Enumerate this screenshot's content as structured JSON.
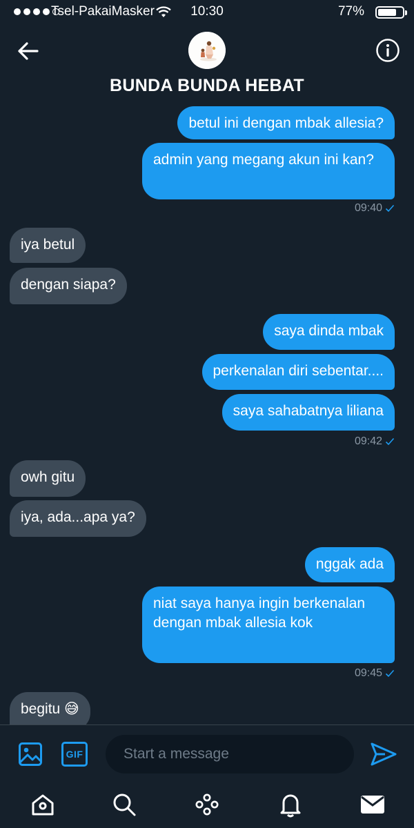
{
  "status_bar": {
    "carrier": "Tsel-PakaiMasker",
    "time": "10:30",
    "battery": "77%",
    "battery_level": 0.77
  },
  "header": {
    "title": "BUNDA BUNDA HEBAT",
    "avatar_icon": "group-avatar-icon"
  },
  "messages": [
    {
      "dir": "sent",
      "text": "betul ini dengan mbak allesia?"
    },
    {
      "dir": "sent",
      "text": "admin yang megang akun ini kan?"
    },
    {
      "time": "09:40"
    },
    {
      "dir": "recv",
      "text": "iya betul"
    },
    {
      "dir": "recv",
      "text": "dengan siapa?"
    },
    {
      "dir": "sent",
      "text": "saya dinda mbak"
    },
    {
      "dir": "sent",
      "text": "perkenalan diri sebentar...."
    },
    {
      "dir": "sent",
      "text": "saya sahabatnya liliana"
    },
    {
      "time": "09:42"
    },
    {
      "dir": "recv",
      "text": "owh gitu"
    },
    {
      "dir": "recv",
      "text": "iya, ada...apa ya?"
    },
    {
      "dir": "sent",
      "text": "nggak ada"
    },
    {
      "dir": "sent",
      "text": "niat saya hanya ingin berkenalan dengan mbak allesia kok"
    },
    {
      "time": "09:45"
    },
    {
      "dir": "recv",
      "text": "begitu 😅"
    }
  ],
  "composer": {
    "placeholder": "Start a message",
    "gif_label": "GIF"
  },
  "colors": {
    "background": "#15202b",
    "sent_bubble": "#1d9bf0",
    "received_bubble": "#3d4a57",
    "muted_text": "#8b98a5"
  }
}
